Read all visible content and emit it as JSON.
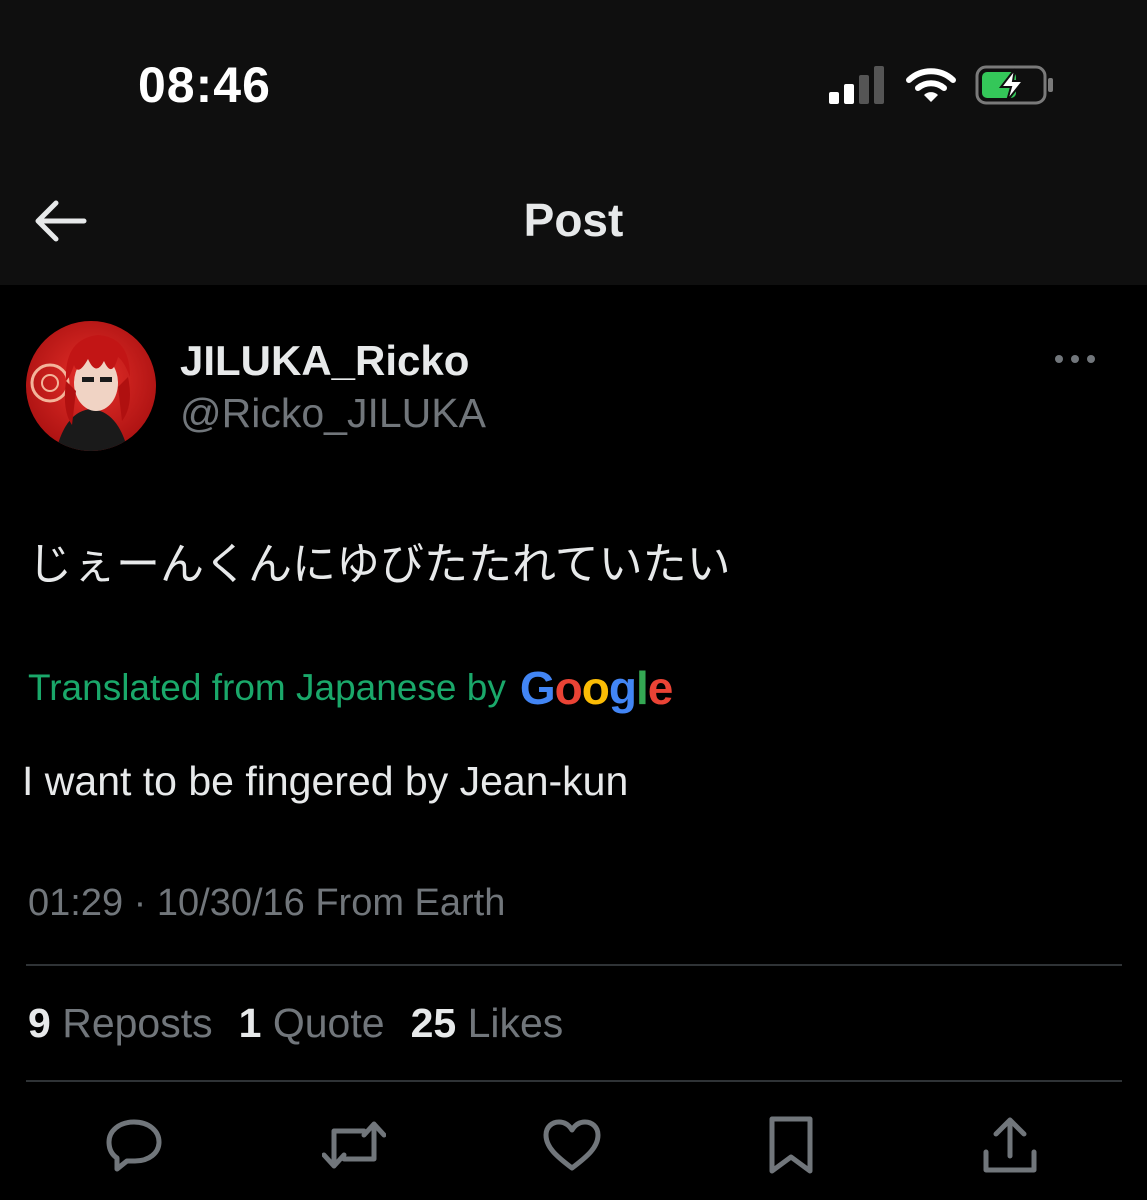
{
  "status_bar": {
    "time": "08:46",
    "icons": [
      "cellular-signal-icon",
      "wifi-icon",
      "battery-charging-icon"
    ]
  },
  "header": {
    "back_icon": "back-arrow-icon",
    "title": "Post"
  },
  "post": {
    "display_name": "JILUKA_Ricko",
    "handle": "@Ricko_JILUKA",
    "text": "じぇーんくんにゆびたたれていたい",
    "translation_label": "Translated from Japanese by",
    "translation_provider": "Google",
    "translated_text": "I want to be fingered by Jean-kun",
    "timestamp": "01:29 · 10/30/16 From Earth"
  },
  "stats": {
    "reposts_count": "9",
    "reposts_label": "Reposts",
    "quotes_count": "1",
    "quotes_label": "Quote",
    "likes_count": "25",
    "likes_label": "Likes"
  },
  "actions": [
    "reply-icon",
    "repost-icon",
    "like-icon",
    "bookmark-icon",
    "share-icon"
  ],
  "colors": {
    "background": "#000000",
    "header_background": "#0f0f0f",
    "primary_text": "#e7e9ea",
    "secondary_text": "#71767b",
    "translation_green": "#1aa86a",
    "battery_green": "#34c759",
    "divider": "#2f3336"
  }
}
